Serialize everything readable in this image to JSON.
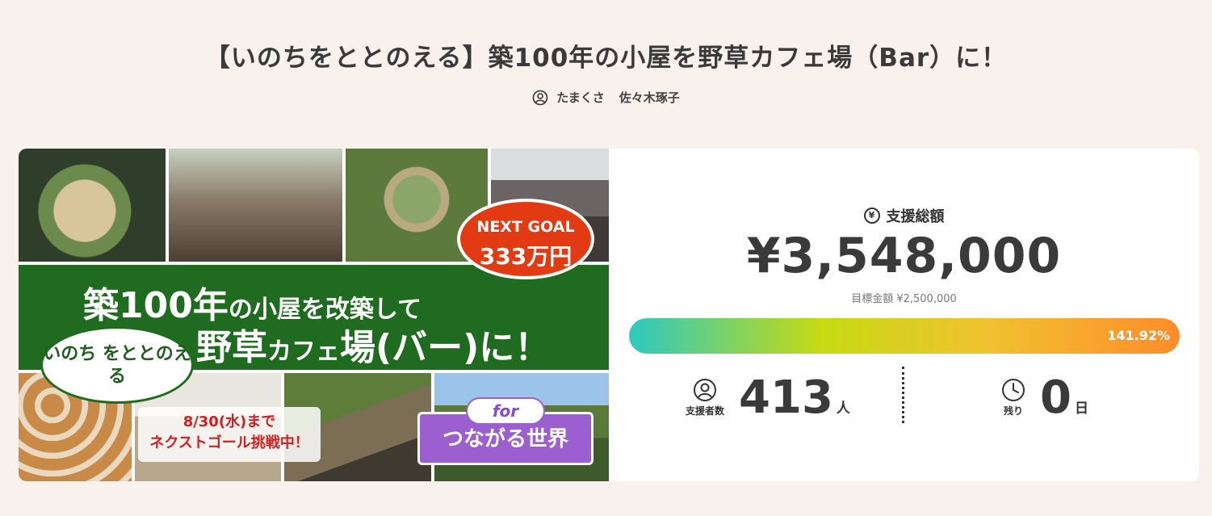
{
  "project": {
    "title": "【いのちをととのえる】築100年の小屋を野草カフェ場（Bar）に！",
    "owner_handle": "たまくさ",
    "owner_name": "佐々木琢子"
  },
  "hero": {
    "next_goal_label": "NEXT GOAL",
    "next_goal_amount": "333万円",
    "headline_part1": "築100年",
    "headline_part2": "の小屋を改築して",
    "headline_part3": "野草",
    "headline_part4": "カフェ",
    "headline_part5": "場(バー)に！",
    "bubble_line1": "いのち をととのえる",
    "deadline_line1": "8/30(水)まで",
    "deadline_line2": "ネクストゴール挑戦中！",
    "for_label": "for",
    "for_text": "つながる世界"
  },
  "stats": {
    "total_label": "支援総額",
    "total_amount": "¥3,548,000",
    "target_text": "目標金額 ¥2,500,000",
    "progress_percent": 141.92,
    "progress_label": "141.92%",
    "supporters_label": "支援者数",
    "supporters_count": "413",
    "supporters_unit": "人",
    "remaining_label": "残り",
    "remaining_value": "0",
    "remaining_unit": "日"
  },
  "colors": {
    "page_bg": "#f9f2ec",
    "band_green": "#1f6b1f",
    "goal_red": "#e23a12",
    "for_purple": "#9b5fd0"
  },
  "icons": {
    "owner": "user-circle-icon",
    "total": "yen-circle-icon",
    "supporters": "user-circle-icon",
    "remaining": "clock-icon"
  }
}
